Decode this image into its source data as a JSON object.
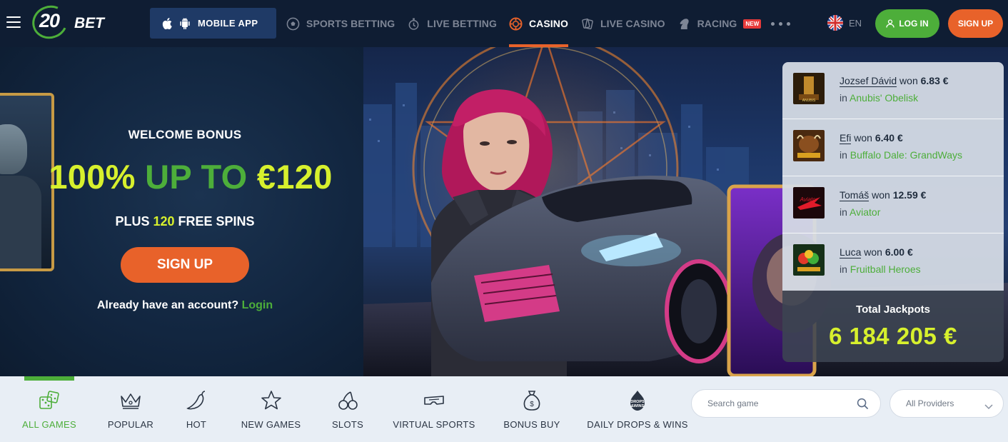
{
  "header": {
    "logo_number": "20",
    "logo_text": "BET",
    "mobile_app_label": "MOBILE APP",
    "nav": [
      {
        "label": "SPORTS BETTING",
        "icon": "soccer-ball-icon",
        "active": false
      },
      {
        "label": "LIVE BETTING",
        "icon": "stopwatch-icon",
        "active": false
      },
      {
        "label": "CASINO",
        "icon": "casino-chip-icon",
        "active": true
      },
      {
        "label": "LIVE CASINO",
        "icon": "playing-cards-icon",
        "active": false
      },
      {
        "label": "RACING",
        "icon": "horse-head-icon",
        "active": false,
        "badge": "NEW"
      }
    ],
    "language": "EN",
    "login_label": "LOG IN",
    "signup_label": "SIGN UP"
  },
  "hero": {
    "title": "WELCOME BONUS",
    "amount_part1": "100%",
    "amount_part2": "UP TO",
    "amount_part3": "€120",
    "spins_prefix": "PLUS",
    "spins_number": "120",
    "spins_suffix": "FREE SPINS",
    "signup_label": "SIGN UP",
    "account_text": "Already have an account?",
    "login_link": "Login"
  },
  "winners": [
    {
      "name": "Jozsef Dávid",
      "won_text": "won",
      "amount": "6.83 €",
      "in_text": "in",
      "game": "Anubis' Obelisk",
      "thumb_color": "#3a2a10"
    },
    {
      "name": "Efi",
      "won_text": "won",
      "amount": "6.40 €",
      "in_text": "in",
      "game": "Buffalo Dale: GrandWays",
      "thumb_color": "#5a3a18"
    },
    {
      "name": "Tomáš",
      "won_text": "won",
      "amount": "12.59 €",
      "in_text": "in",
      "game": "Aviator",
      "thumb_color": "#2a0c10"
    },
    {
      "name": "Luca",
      "won_text": "won",
      "amount": "6.00 €",
      "in_text": "in",
      "game": "Fruitball Heroes",
      "thumb_color": "#1e3a1a"
    }
  ],
  "jackpot": {
    "label": "Total Jackpots",
    "value": "6 184 205 €"
  },
  "categories": [
    {
      "label": "ALL GAMES",
      "icon": "dice-icon",
      "active": true
    },
    {
      "label": "POPULAR",
      "icon": "crown-icon",
      "active": false
    },
    {
      "label": "HOT",
      "icon": "chili-pepper-icon",
      "active": false
    },
    {
      "label": "NEW GAMES",
      "icon": "star-icon",
      "active": false
    },
    {
      "label": "SLOTS",
      "icon": "cherries-icon",
      "active": false
    },
    {
      "label": "VIRTUAL SPORTS",
      "icon": "vr-goggles-icon",
      "active": false
    },
    {
      "label": "BONUS BUY",
      "icon": "money-bag-icon",
      "active": false
    },
    {
      "label": "DAILY DROPS & WINS",
      "icon": "drops-and-wins-icon",
      "active": false
    }
  ],
  "search": {
    "placeholder": "Search game"
  },
  "providers": {
    "selected": "All Providers"
  },
  "colors": {
    "brand_green": "#4dae3a",
    "brand_orange": "#e8622a",
    "highlight_yellow": "#d7f02d",
    "header_bg": "#0f1d33"
  }
}
